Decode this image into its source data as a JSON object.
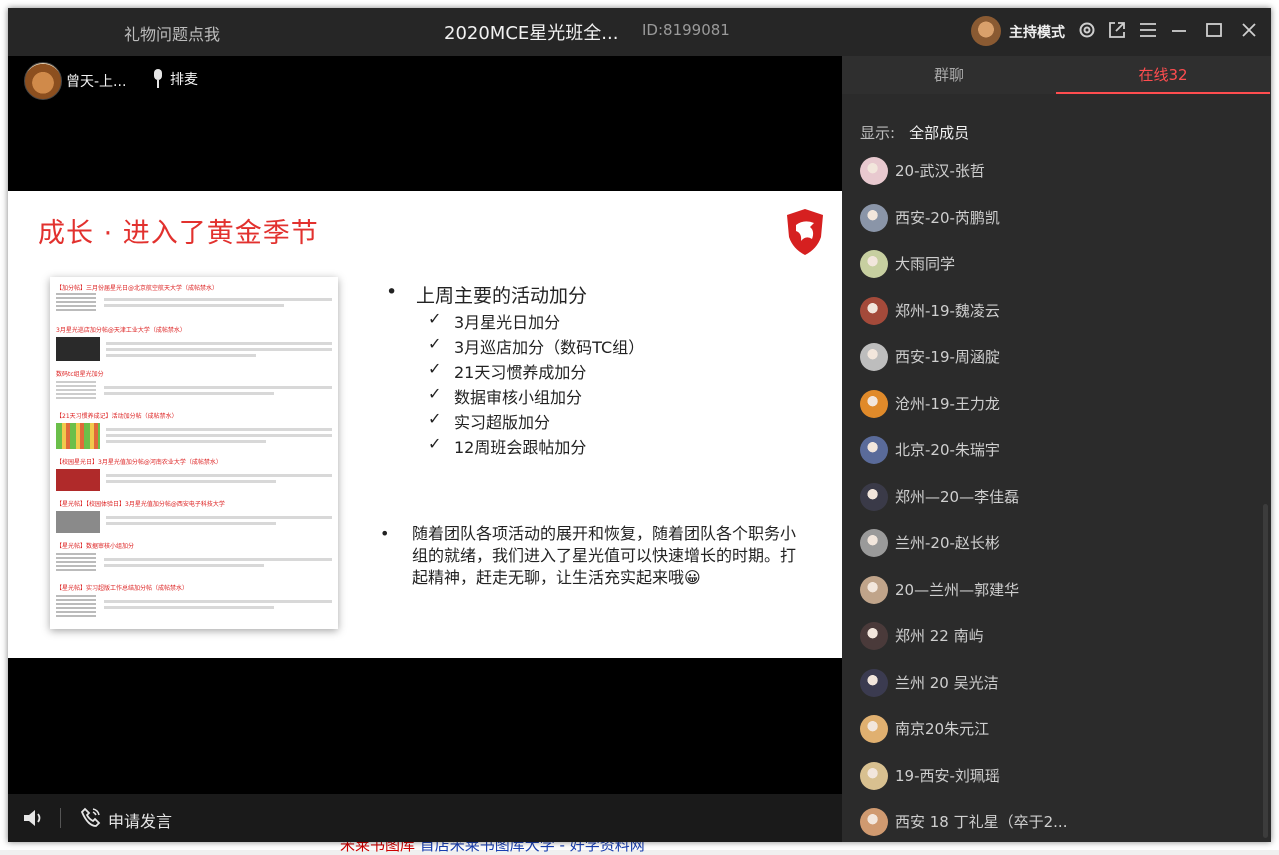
{
  "background_page": {
    "bottom_text_red": "米莱书图库",
    "bottom_text_blue": " 首店米莱书图库大学 - 好学资料网"
  },
  "titlebar": {
    "gift_link": "礼物问题点我",
    "room_title": "2020MCE星光班全...",
    "room_id": "ID:8199081",
    "host_mode_label": "主持模式",
    "icons": [
      "settings-icon",
      "popout-icon",
      "menu-icon",
      "minimize-icon",
      "maximize-icon",
      "close-icon"
    ]
  },
  "stage": {
    "presenter_name": "曾天-上...",
    "mic_queue_label": "排麦",
    "apply_speak_label": "申请发言"
  },
  "slide": {
    "title": "成长 · 进入了黄金季节",
    "main_bullet": "上周主要的活动加分",
    "check_items": [
      "3月星光日加分",
      "3月巡店加分（数码TC组）",
      "21天习惯养成加分",
      "数据审核小组加分",
      "实习超版加分",
      "12周班会跟帖加分"
    ],
    "bullet_two": "随着团队各项活动的展开和恢复，随着团队各个职务小组的就绪，我们进入了星光值可以快速增长的时期。打起精神，赶走无聊，让生活充实起来哦😀",
    "thumb_posts": [
      "【加分帖】三月份届星光日@北京航空航天大学（成帖禁水）",
      "3月星光巡店加分帖@天津工业大学（成帖禁水）",
      "数码tc组星光加分",
      "【21天习惯养成记】活动加分帖（成帖禁水）",
      "【校园星光日】3月星光值加分帖@河南农业大学（成帖禁水）",
      "【星光帖】【校园体验日】3月星光值加分帖@西安电子科技大学",
      "【星光帖】数据审核小组加分",
      "【星光帖】实习超版工作总结加分帖（成帖禁水）"
    ]
  },
  "sidebar": {
    "tabs": [
      "群聊",
      "在线32"
    ],
    "filter_label": "显示:",
    "filter_value": "全部成员",
    "members": [
      {
        "name": "20-武汉-张哲",
        "color": "#e8c9cf"
      },
      {
        "name": "西安-20-芮鹏凯",
        "color": "#8a95a8"
      },
      {
        "name": "大雨同学",
        "color": "#c7cfa0"
      },
      {
        "name": "郑州-19-魏凌云",
        "color": "#a44a3a"
      },
      {
        "name": "西安-19-周涵腚",
        "color": "#bdbdbd"
      },
      {
        "name": "沧州-19-王力龙",
        "color": "#e08a2a"
      },
      {
        "name": "北京-20-朱瑞宇",
        "color": "#5a6b9a"
      },
      {
        "name": "郑州—20—李佳磊",
        "color": "#3a3a48"
      },
      {
        "name": "兰州-20-赵长彬",
        "color": "#9a9a9a"
      },
      {
        "name": "20—兰州—郭建华",
        "color": "#c0a48a"
      },
      {
        "name": "郑州 22 南屿",
        "color": "#4a3a3a"
      },
      {
        "name": "兰州    20  吴光洁",
        "color": "#3b3b50"
      },
      {
        "name": "南京20朱元江",
        "color": "#e0b070"
      },
      {
        "name": "19-西安-刘珮瑶",
        "color": "#d8c090"
      },
      {
        "name": "西安 18 丁礼星（卒于2...",
        "color": "#d09a70"
      }
    ]
  },
  "colors": {
    "accent_red": "#ff4d4f",
    "slide_title_red": "#e2312e"
  }
}
